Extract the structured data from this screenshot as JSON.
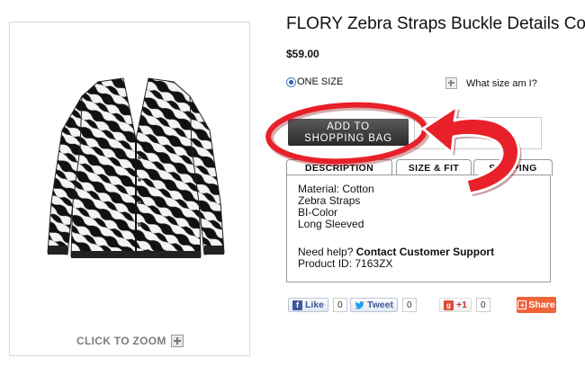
{
  "product": {
    "title": "FLORY Zebra Straps Buckle Details Coat",
    "price": "$59.00",
    "size_option": "ONE SIZE",
    "size_help": "What size am I?",
    "zoom_label": "CLICK TO ZOOM"
  },
  "add_to_bag": {
    "line1": "ADD TO",
    "line2": "SHOPPING BAG"
  },
  "tabs": [
    {
      "label": "DESCRIPTION"
    },
    {
      "label": "SIZE & FIT"
    },
    {
      "label": "SHIPPING"
    }
  ],
  "description": {
    "lines": [
      "Material: Cotton",
      "Zebra Straps",
      "BI-Color",
      "Long Sleeved"
    ],
    "help_prefix": "Need help?",
    "help_link": "Contact Customer Support",
    "product_id_label": "Product ID:",
    "product_id": "7163ZX"
  },
  "social": {
    "like_label": "Like",
    "like_count": "0",
    "tweet_label": "Tweet",
    "tweet_count": "0",
    "gplus_label": "+1",
    "gplus_count": "0",
    "share_label": "Share"
  },
  "colors": {
    "annotation_red": "#e8202a",
    "button_dark": "#333333",
    "share_orange": "#f0643a",
    "facebook_blue": "#3b5998"
  },
  "icons": [
    "zoom-plus-icon",
    "size-help-plus-icon",
    "facebook-icon",
    "twitter-icon",
    "google-plus-icon",
    "share-icon",
    "radio-selected-icon"
  ]
}
